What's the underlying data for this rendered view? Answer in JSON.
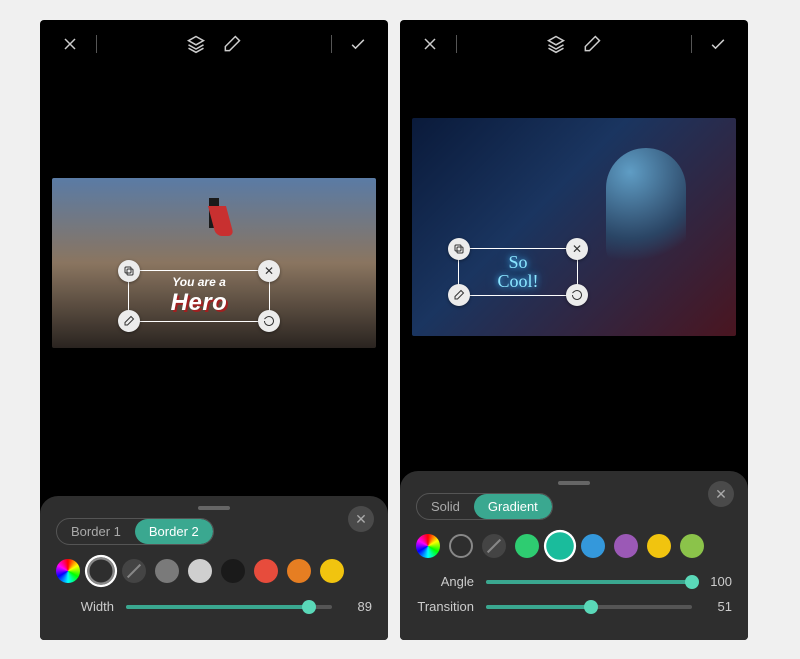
{
  "screens": [
    {
      "canvas_text": {
        "sup": "You are a",
        "main": "Hero"
      },
      "panel": {
        "tabs": [
          {
            "label": "Border 1",
            "active": false
          },
          {
            "label": "Border 2",
            "active": true
          }
        ],
        "swatches": [
          {
            "type": "rainbow"
          },
          {
            "type": "ring",
            "selected": true
          },
          {
            "type": "none"
          },
          {
            "color": "#7a7a7a"
          },
          {
            "color": "#cfcfcf"
          },
          {
            "color": "#1a1a1a"
          },
          {
            "color": "#e74c3c"
          },
          {
            "color": "#e67e22"
          },
          {
            "color": "#f1c40f"
          }
        ],
        "sliders": [
          {
            "label": "Width",
            "value": 89,
            "max": 100
          }
        ]
      }
    },
    {
      "canvas_text": {
        "line1": "So",
        "line2": "Cool!"
      },
      "panel": {
        "tabs": [
          {
            "label": "Solid",
            "active": false
          },
          {
            "label": "Gradient",
            "active": true
          }
        ],
        "swatches": [
          {
            "type": "rainbow"
          },
          {
            "type": "ring"
          },
          {
            "type": "none"
          },
          {
            "color": "#2ecc71"
          },
          {
            "color": "#1abc9c",
            "selected": true
          },
          {
            "color": "#3498db"
          },
          {
            "color": "#9b59b6"
          },
          {
            "color": "#f1c40f"
          },
          {
            "color": "#8bc34a"
          }
        ],
        "sliders": [
          {
            "label": "Angle",
            "value": 100,
            "max": 100
          },
          {
            "label": "Transition",
            "value": 51,
            "max": 100
          }
        ]
      }
    }
  ]
}
